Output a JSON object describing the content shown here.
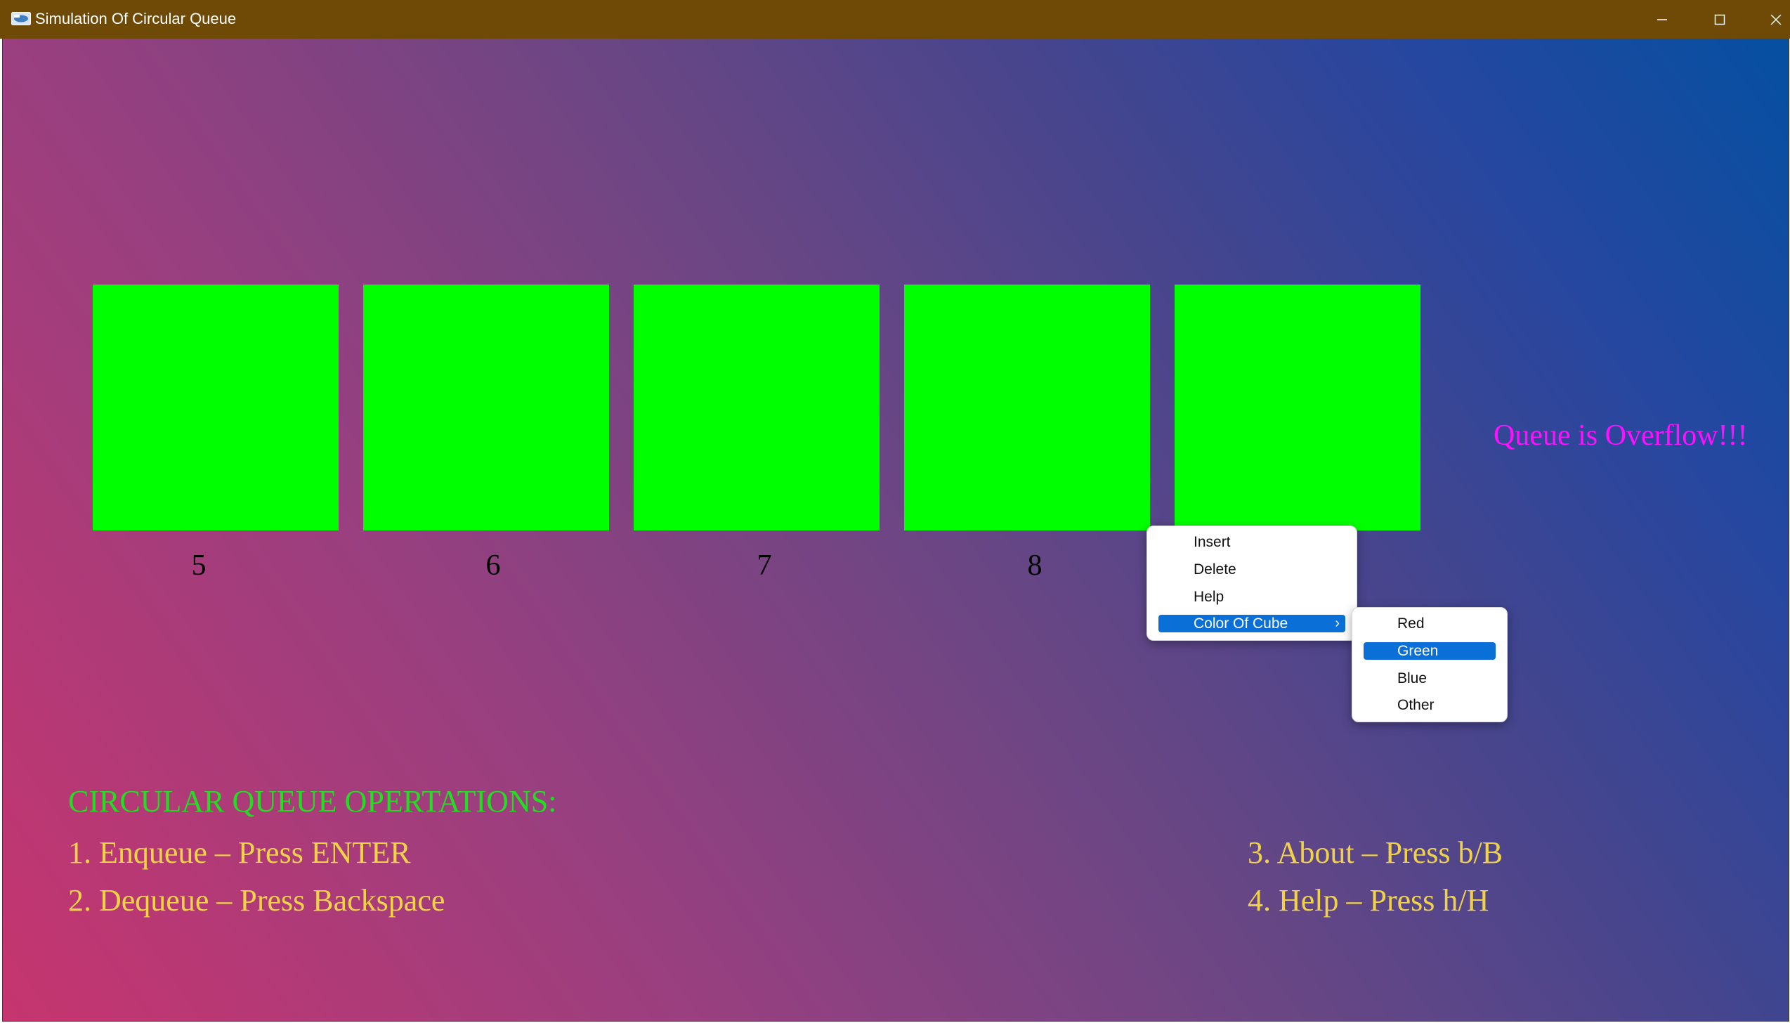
{
  "window": {
    "title": "Simulation Of Circular Queue"
  },
  "queue": {
    "cube_color": "#00ff00",
    "labels": [
      "5",
      "6",
      "7",
      "8"
    ],
    "status_message": "Queue is Overflow!!!"
  },
  "instructions": {
    "heading": "CIRCULAR QUEUE OPERTATIONS:",
    "enqueue": "1. Enqueue – Press ENTER",
    "dequeue": "2. Dequeue – Press Backspace",
    "about": "3. About – Press b/B",
    "help": "4. Help – Press h/H"
  },
  "context_menu": {
    "items": [
      "Insert",
      "Delete",
      "Help",
      "Color Of Cube"
    ],
    "highlighted": "Color Of Cube"
  },
  "color_submenu": {
    "items": [
      "Red",
      "Green",
      "Blue",
      "Other"
    ],
    "highlighted": "Green"
  },
  "colors": {
    "titlebar": "#6f4a06",
    "overflow_text": "#ff10ff",
    "heading_text": "#22dd22",
    "instruction_text": "#f0d24a",
    "menu_highlight": "#0a6fd6"
  }
}
